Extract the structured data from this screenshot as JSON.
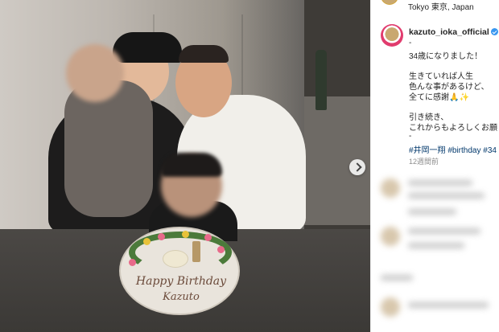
{
  "post": {
    "location": "Tokyo 東京, Japan",
    "username": "kazuto_ioka_official",
    "caption": [
      "-",
      "34歳になりました！",
      "",
      "生きていれば人生",
      "色んな事があるけど、",
      "全てに感謝🙏✨",
      "",
      "引き続き、",
      "これからもよろしくお願",
      "-"
    ],
    "hashtags": "#井岡一翔 #birthday #34",
    "time_ago": "12週間前"
  },
  "cake": {
    "line1": "Happy Birthday",
    "line2": "Kazuto"
  },
  "colors": {
    "text": "#262626",
    "hashtag": "#00376b",
    "verified": "#3897f0",
    "muted": "#8e8e8e"
  }
}
